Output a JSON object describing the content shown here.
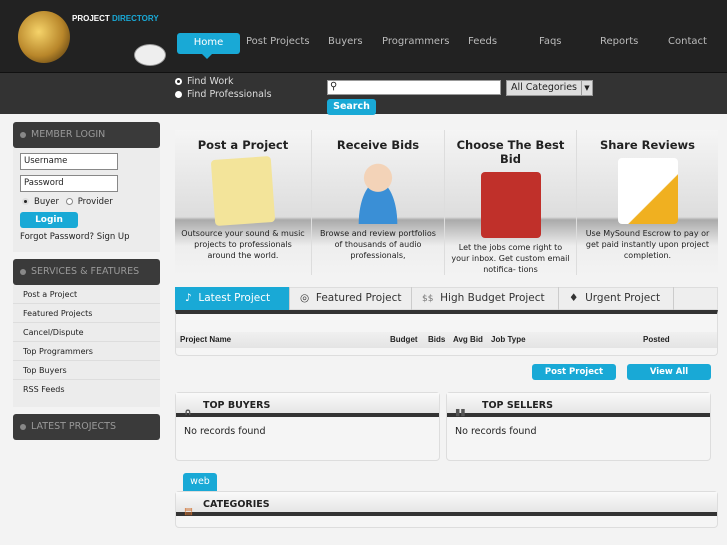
{
  "logo": {
    "text1": "PROJECT",
    "text2": "DIRECTORY"
  },
  "nav": [
    {
      "label": "Home"
    },
    {
      "label": "Post Projects"
    },
    {
      "label": "Buyers"
    },
    {
      "label": "Programmers"
    },
    {
      "label": "Feeds"
    },
    {
      "label": "Faqs"
    },
    {
      "label": "Reports"
    },
    {
      "label": "Contact"
    }
  ],
  "search": {
    "find_work": "Find Work",
    "find_professionals": "Find Professionals",
    "category": "All Categories",
    "button": "Search",
    "value": ""
  },
  "sidebar": {
    "login_title": "MEMBER LOGIN",
    "username": "Username",
    "password": "Password",
    "buyer": "Buyer",
    "provider": "Provider",
    "login": "Login",
    "forgot": "Forgot Password?",
    "signup": "Sign Up",
    "services_title": "SERVICES & FEATURES",
    "items": [
      "Post a Project",
      "Featured Projects",
      "Cancel/Dispute",
      "Top Programmers",
      "Top Buyers",
      "RSS Feeds"
    ],
    "latest_title": "LATEST PROJECTS"
  },
  "steps": [
    {
      "title": "Post a Project",
      "desc": "Outsource your sound & music projects to professionals around the world."
    },
    {
      "title": "Receive Bids",
      "desc": "Browse and review portfolios of thousands of audio professionals,"
    },
    {
      "title": "Choose The Best Bid",
      "desc": "Let the jobs come right to your inbox.  Get custom email notifica- tions"
    },
    {
      "title": "Share Reviews",
      "desc": "Use MySound Escrow to pay or get paid instantly upon project completion."
    }
  ],
  "tabs": [
    {
      "label": "Latest Project",
      "icon": "♪"
    },
    {
      "label": "Featured Project",
      "icon": "◎"
    },
    {
      "label": "High Budget Project",
      "icon": "$$"
    },
    {
      "label": "Urgent Project",
      "icon": "♦"
    }
  ],
  "table": {
    "columns": [
      "Project Name",
      "Budget",
      "Bids",
      "Avg Bid",
      "Job Type",
      "Posted"
    ]
  },
  "actions": {
    "post": "Post Project",
    "view_all": "View All"
  },
  "top_buyers": {
    "title": "TOP BUYERS",
    "empty": "No records found"
  },
  "top_sellers": {
    "title": "TOP SELLERS",
    "empty": "No records found"
  },
  "categories": {
    "tab": "web",
    "title": "CATEGORIES"
  },
  "colors": {
    "accent": "#19a9d6",
    "header": "#222222"
  }
}
